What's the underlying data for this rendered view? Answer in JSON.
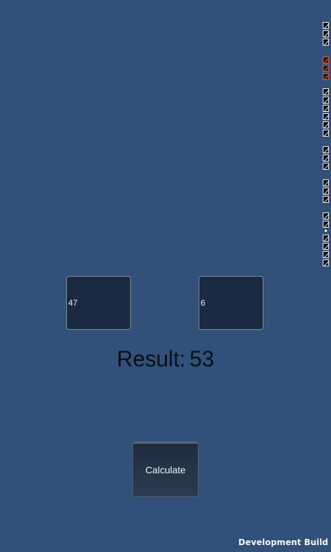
{
  "inputs": {
    "first_value": "47",
    "second_value": "6"
  },
  "result": {
    "label": "Result:",
    "value": "53"
  },
  "calculate_button": {
    "label": "Calculate"
  },
  "footer": {
    "build_label": "Development Build"
  },
  "colors": {
    "background": "#31507a",
    "input_fill": "#1a2a40",
    "debug_accent": "#e25b2f"
  }
}
